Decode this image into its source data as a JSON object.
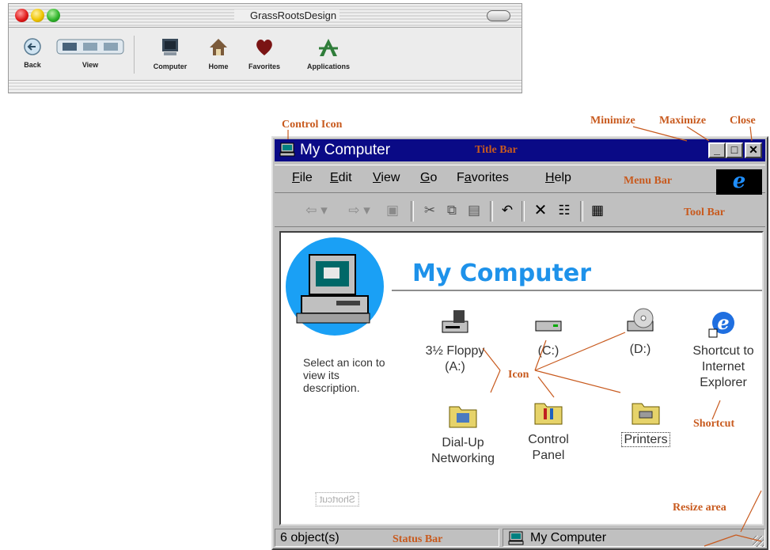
{
  "mac_window": {
    "title": "GrassRootsDesign",
    "toolbar": [
      {
        "label": "Back",
        "icon": "back-arrow-icon"
      },
      {
        "label": "View",
        "icon": "view-switcher-icon"
      },
      {
        "label": "Computer",
        "icon": "computer-icon"
      },
      {
        "label": "Home",
        "icon": "house-icon"
      },
      {
        "label": "Favorites",
        "icon": "heart-icon"
      },
      {
        "label": "Applications",
        "icon": "applications-icon"
      }
    ]
  },
  "windows_window": {
    "title": "My Computer",
    "title_buttons": {
      "minimize": "_",
      "maximize": "□",
      "close": "✕"
    },
    "menu": [
      "File",
      "Edit",
      "View",
      "Go",
      "Favorites",
      "Help"
    ],
    "menu_accel": [
      "F",
      "E",
      "V",
      "G",
      "a",
      "H"
    ],
    "toolbar_glyphs": {
      "back": "⇦ ▾",
      "forward": "⇨ ▾",
      "up": "▣",
      "cut": "✂",
      "copy": "⧉",
      "paste": "▤",
      "undo": "↶",
      "delete": "✕",
      "properties": "☷",
      "views": "▦"
    },
    "content": {
      "heading": "My Computer",
      "description": "Select an icon to view its description.",
      "items": [
        {
          "label": "3½ Floppy (A:)",
          "icon": "floppy-drive-icon"
        },
        {
          "label": "(C:)",
          "icon": "hard-drive-icon"
        },
        {
          "label": "(D:)",
          "icon": "cd-drive-icon"
        },
        {
          "label": "Shortcut to Internet Explorer",
          "icon": "internet-explorer-icon"
        },
        {
          "label": "Dial-Up Networking",
          "icon": "folder-icon"
        },
        {
          "label": "Control Panel",
          "icon": "folder-icon"
        },
        {
          "label": "Printers",
          "icon": "folder-icon"
        }
      ],
      "watermark": "Shortcut"
    },
    "status": {
      "objects": "6 object(s)",
      "location": "My Computer"
    }
  },
  "annotations": {
    "control_icon": "Control Icon",
    "minimize": "Minimize",
    "maximize": "Maximize",
    "close": "Close",
    "title_bar": "Title Bar",
    "menu_bar": "Menu Bar",
    "tool_bar": "Tool Bar",
    "icon": "Icon",
    "shortcut": "Shortcut",
    "resize_area": "Resize area",
    "status_bar": "Status Bar"
  },
  "colors": {
    "title_bar": "#0a0a86",
    "heading": "#1e92ea",
    "callout": "#c85a1e",
    "window_face": "#c0c0c0"
  }
}
